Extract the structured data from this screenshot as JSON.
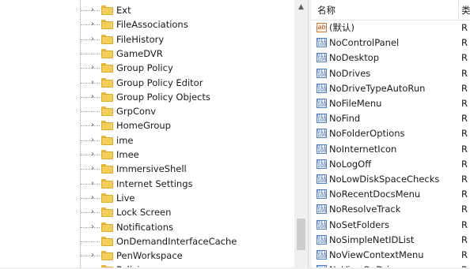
{
  "tree": {
    "items": [
      {
        "label": "Ext",
        "expandable": true
      },
      {
        "label": "FileAssociations",
        "expandable": true
      },
      {
        "label": "FileHistory",
        "expandable": true
      },
      {
        "label": "GameDVR",
        "expandable": false
      },
      {
        "label": "Group Policy",
        "expandable": true
      },
      {
        "label": "Group Policy Editor",
        "expandable": true
      },
      {
        "label": "Group Policy Objects",
        "expandable": true
      },
      {
        "label": "GrpConv",
        "expandable": false
      },
      {
        "label": "HomeGroup",
        "expandable": true
      },
      {
        "label": "ime",
        "expandable": true
      },
      {
        "label": "Imee",
        "expandable": true
      },
      {
        "label": "ImmersiveShell",
        "expandable": true
      },
      {
        "label": "Internet Settings",
        "expandable": true
      },
      {
        "label": "Live",
        "expandable": true
      },
      {
        "label": "Lock Screen",
        "expandable": true
      },
      {
        "label": "Notifications",
        "expandable": true
      },
      {
        "label": "OnDemandInterfaceCache",
        "expandable": false
      },
      {
        "label": "PenWorkspace",
        "expandable": true
      },
      {
        "label": "Policies",
        "expandable": true
      }
    ]
  },
  "values": {
    "header": {
      "name": "名称",
      "type": "类"
    },
    "rows": [
      {
        "name": "(默认)",
        "type": "R",
        "icon": "string-value-icon"
      },
      {
        "name": "NoControlPanel",
        "type": "R",
        "icon": "binary-value-icon"
      },
      {
        "name": "NoDesktop",
        "type": "R",
        "icon": "binary-value-icon"
      },
      {
        "name": "NoDrives",
        "type": "R",
        "icon": "binary-value-icon"
      },
      {
        "name": "NoDriveTypeAutoRun",
        "type": "R",
        "icon": "binary-value-icon"
      },
      {
        "name": "NoFileMenu",
        "type": "R",
        "icon": "binary-value-icon"
      },
      {
        "name": "NoFind",
        "type": "R",
        "icon": "binary-value-icon"
      },
      {
        "name": "NoFolderOptions",
        "type": "R",
        "icon": "binary-value-icon"
      },
      {
        "name": "NoInternetIcon",
        "type": "R",
        "icon": "binary-value-icon"
      },
      {
        "name": "NoLogOff",
        "type": "R",
        "icon": "binary-value-icon"
      },
      {
        "name": "NoLowDiskSpaceChecks",
        "type": "R",
        "icon": "binary-value-icon"
      },
      {
        "name": "NoRecentDocsMenu",
        "type": "R",
        "icon": "binary-value-icon"
      },
      {
        "name": "NoResolveTrack",
        "type": "R",
        "icon": "binary-value-icon"
      },
      {
        "name": "NoSetFolders",
        "type": "R",
        "icon": "binary-value-icon"
      },
      {
        "name": "NoSimpleNetIDList",
        "type": "R",
        "icon": "binary-value-icon"
      },
      {
        "name": "NoViewContextMenu",
        "type": "R",
        "icon": "binary-value-icon"
      },
      {
        "name": "NoViewOnDrive",
        "type": "R",
        "icon": "binary-value-icon"
      }
    ]
  },
  "colors": {
    "folder": "#f3cf5a",
    "folder_border": "#dcac2c",
    "scrollbar_thumb": "#cdcdcd"
  }
}
